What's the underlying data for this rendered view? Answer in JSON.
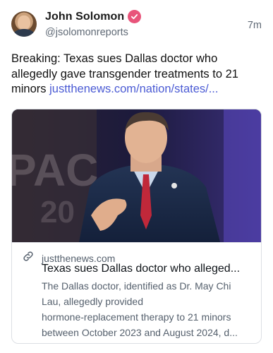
{
  "post": {
    "author_name": "John Solomon",
    "author_handle": "@jsolomonreports",
    "timestamp": "7m",
    "verified_icon": "check-badge-icon",
    "text": "Breaking: Texas sues Dallas doctor who allegedly gave transgender treatments to 21 minors",
    "link_text": "justthenews.com/nation/states/..."
  },
  "card": {
    "domain": "justthenews.com",
    "title": "Texas sues Dallas doctor who alleged...",
    "description_lines": [
      "The Dallas doctor, identified as Dr. May Chi",
      "Lau, allegedly provided",
      "hormone-replacement therapy to 21 minors",
      "between October 2023 and August 2024, d..."
    ],
    "link_icon": "link-icon"
  },
  "colors": {
    "link": "#4b5bd4",
    "badge": "#e8547a",
    "muted": "#606a76"
  }
}
